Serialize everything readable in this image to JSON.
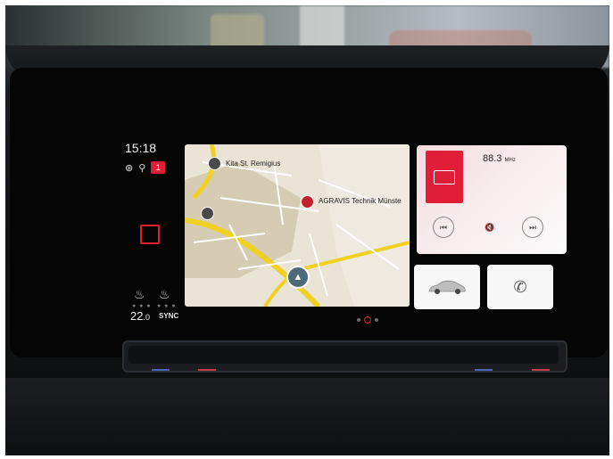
{
  "status_bar": {
    "time": "15:18",
    "notification_count": "1"
  },
  "climate": {
    "temperature": "22.0",
    "temperature_whole": "22",
    "temperature_decimal": ".0",
    "sync_label": "SYNC"
  },
  "map": {
    "poi_labels": [
      "Kita St. Remigius",
      "AGRAVIS Technik Münste"
    ],
    "pager": {
      "pages": 3,
      "active": 2
    }
  },
  "radio": {
    "frequency": "88.3",
    "unit": "MHz"
  },
  "icons": {
    "radio": "radio-icon",
    "previous": "skip-previous-icon",
    "mute": "speaker-mute-icon",
    "next": "skip-next-icon",
    "car": "car-icon",
    "phone": "phone-icon",
    "gps": "gps-icon",
    "assistance": "driver-assist-icon",
    "home": "home-icon",
    "seat_heat_left": "seat-heat-left-icon",
    "seat_heat_right": "seat-heat-right-icon"
  },
  "colors": {
    "accent": "#e01e37",
    "map_background": "#e9e4d5",
    "road_major": "#f0d020"
  }
}
